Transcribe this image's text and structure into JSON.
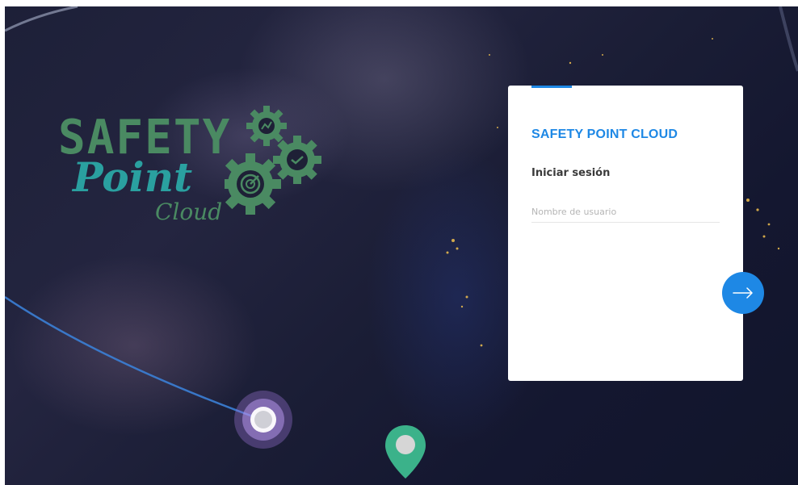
{
  "logo": {
    "line1": "SAFETY",
    "line2": "Point",
    "line3": "Cloud"
  },
  "login": {
    "title": "SAFETY POINT CLOUD",
    "subtitle": "Iniciar sesión",
    "username_placeholder": "Nombre de usuario",
    "username_value": ""
  },
  "next_button": {
    "icon": "arrow-right-icon"
  },
  "colors": {
    "accent": "#1e88e5",
    "logo_green": "#4a8a62",
    "logo_teal": "#2aa0a0",
    "marker_green": "#3bb28a"
  }
}
